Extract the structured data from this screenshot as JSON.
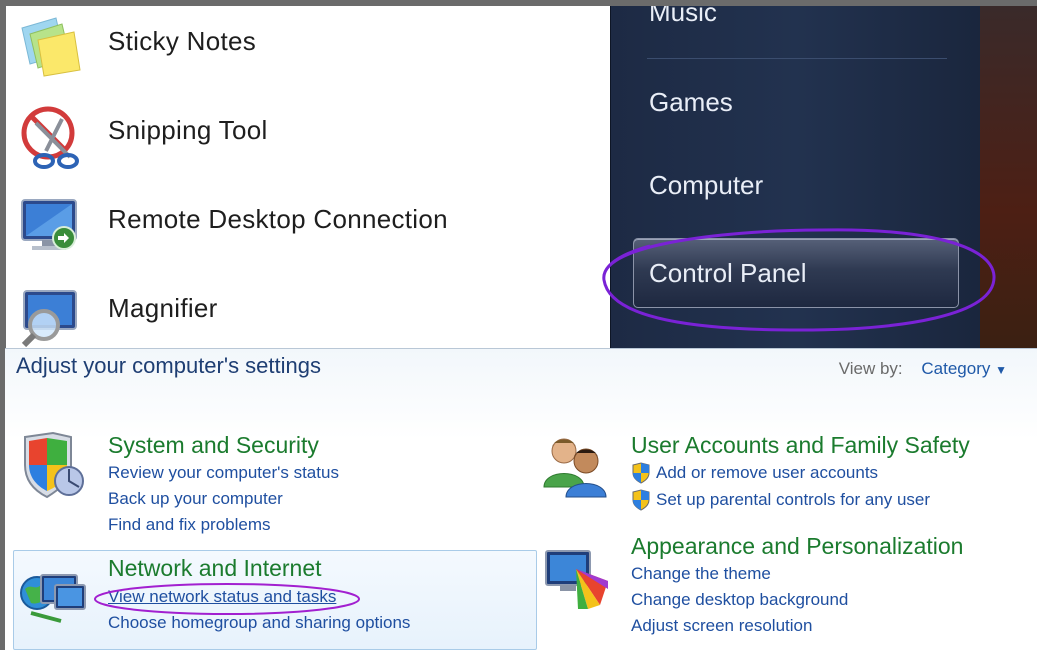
{
  "start_menu": {
    "programs": [
      {
        "label": "Sticky Notes",
        "icon": "sticky-notes-icon"
      },
      {
        "label": "Snipping Tool",
        "icon": "snipping-tool-icon"
      },
      {
        "label": "Remote Desktop Connection",
        "icon": "remote-desktop-icon"
      },
      {
        "label": "Magnifier",
        "icon": "magnifier-icon"
      }
    ],
    "right_items": {
      "music": "Music",
      "games": "Games",
      "computer": "Computer",
      "control_panel": "Control Panel"
    },
    "highlight_color": "#7a22d6"
  },
  "control_panel": {
    "title": "Adjust your computer's settings",
    "view_by_label": "View by:",
    "view_by_value": "Category",
    "categories": [
      {
        "heading": "System and Security",
        "icon": "security-shield-icon",
        "links": [
          "Review your computer's status",
          "Back up your computer",
          "Find and fix problems"
        ]
      },
      {
        "heading": "Network and Internet",
        "icon": "network-globe-icon",
        "links": [
          "View network status and tasks",
          "Choose homegroup and sharing options"
        ]
      },
      {
        "heading": "User Accounts and Family Safety",
        "icon": "users-icon",
        "links": [
          "Add or remove user accounts",
          "Set up parental controls for any user"
        ]
      },
      {
        "heading": "Appearance and Personalization",
        "icon": "appearance-icon",
        "links": [
          "Change the theme",
          "Change desktop background",
          "Adjust screen resolution"
        ]
      }
    ],
    "heading_color": "#1b7b2e",
    "link_color": "#1f4fa0"
  }
}
